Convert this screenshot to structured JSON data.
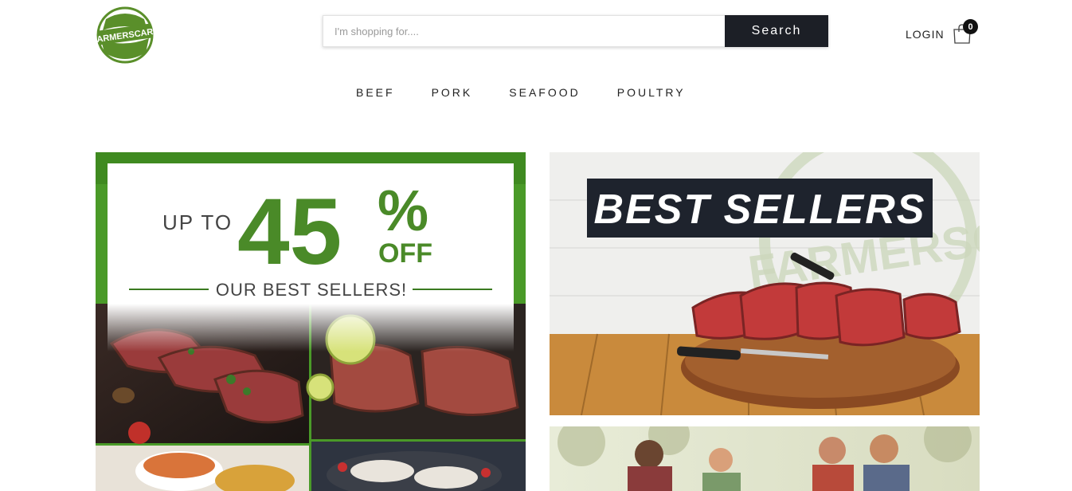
{
  "brand": {
    "logo_text": "FARMERSCART",
    "color": "#4a8a1f"
  },
  "search": {
    "placeholder": "I'm shopping for....",
    "button_label": "Search"
  },
  "header": {
    "login_label": "LOGIN",
    "cart_count": "0"
  },
  "nav": {
    "items": [
      "BEEF",
      "PORK",
      "SEAFOOD",
      "POULTRY"
    ]
  },
  "promo": {
    "up_to": "UP TO",
    "big_number": "45",
    "percent": "%",
    "off": "OFF",
    "subtitle": "OUR BEST SELLERS!",
    "accent": "#4a9a28"
  },
  "best_sellers": {
    "title": "BEST SELLERS",
    "watermark": "FARMERSCART"
  },
  "icons": {
    "search": "search-icon",
    "cart": "cart-icon"
  }
}
